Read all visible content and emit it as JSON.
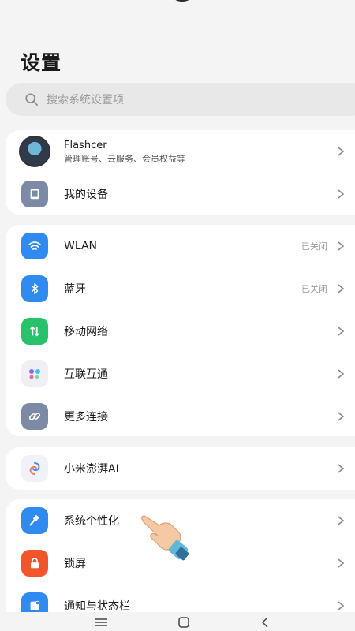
{
  "header": {
    "title": "设置"
  },
  "search": {
    "placeholder": "搜索系统设置项"
  },
  "account": {
    "name": "Flashcer",
    "subtitle": "管理账号、云服务、会员权益等"
  },
  "device": {
    "label": "我的设备"
  },
  "network": [
    {
      "label": "WLAN",
      "status": "已关闭",
      "icon": "wifi-icon",
      "color": "#2f8bf0"
    },
    {
      "label": "蓝牙",
      "status": "已关闭",
      "icon": "bluetooth-icon",
      "color": "#2f8bf0"
    },
    {
      "label": "移动网络",
      "status": "",
      "icon": "mobile-network-icon",
      "color": "#27c26a"
    },
    {
      "label": "互联互通",
      "status": "",
      "icon": "interconnect-icon",
      "color": "#eef0f5"
    },
    {
      "label": "更多连接",
      "status": "",
      "icon": "link-icon",
      "color": "#7d8aa6"
    }
  ],
  "ai": {
    "label": "小米澎湃AI"
  },
  "personal": [
    {
      "label": "系统个性化",
      "icon": "brush-icon",
      "color": "#2f8bf0"
    },
    {
      "label": "锁屏",
      "icon": "lock-icon",
      "color": "#f2552c"
    },
    {
      "label": "通知与状态栏",
      "icon": "notification-icon",
      "color": "#2f8bf0"
    }
  ]
}
